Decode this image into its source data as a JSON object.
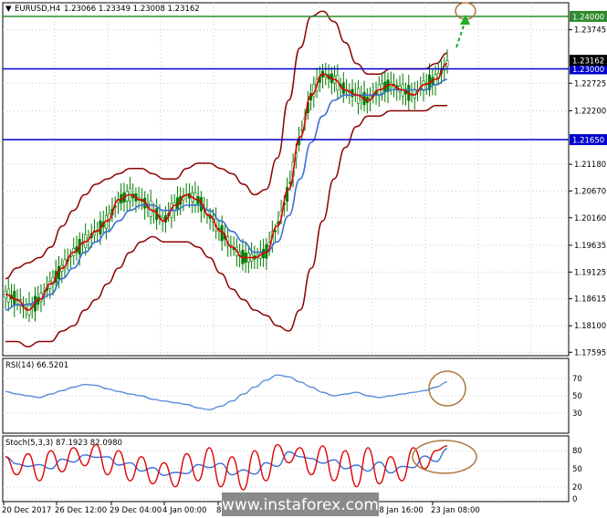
{
  "header": {
    "symbol": "EURUSD,H4",
    "ohlc": "1.23066 1.23349 1.23008 1.23162"
  },
  "price_axis": {
    "ticks": [
      "1.23745",
      "1.22725",
      "1.22200",
      "1.21180",
      "1.20670",
      "1.20160",
      "1.19635",
      "1.19125",
      "1.18615",
      "1.18100",
      "1.17595"
    ],
    "current_price": "1.23162",
    "levels": [
      {
        "label": "1.24000",
        "value": 1.24,
        "color": "#2e8b2e"
      },
      {
        "label": "1.23000",
        "value": 1.23,
        "color": "#0000cc"
      },
      {
        "label": "1.21650",
        "value": 1.2165,
        "color": "#0000cc"
      }
    ]
  },
  "time_axis": {
    "labels": [
      "20 Dec 2017",
      "26 Dec 12:00",
      "29 Dec 04:00",
      "4 Jan 00:00",
      "8",
      "18 Jan 16:00",
      "23 Jan 08:00"
    ]
  },
  "rsi": {
    "title": "RSI(14) 66.5201",
    "ticks": [
      "70",
      "50",
      "30"
    ]
  },
  "stoch": {
    "title": "Stoch(5,3,3) 87.1923 82.0980",
    "ticks": [
      "80",
      "50",
      "20",
      "0"
    ]
  },
  "watermark": "www.instaforex.com",
  "colors": {
    "upper_level": "#2e8b2e",
    "blue_level": "#0000cc",
    "bollinger": "#8b0000",
    "ma_fast": "#e00000",
    "ma_slow": "#3a6fd8",
    "candles": "#007a00",
    "rsi_line": "#5b8fd9",
    "stoch_main": "#e00000",
    "stoch_signal": "#3a6fd8",
    "annotation": "#b07840",
    "arrow": "#22aa22"
  },
  "chart_data": {
    "type": "line",
    "title": "EURUSD,H4",
    "ylim": [
      1.1753,
      1.2426
    ],
    "levels": [
      1.24,
      1.23,
      1.2165
    ],
    "series": [
      {
        "values": [
          1.187,
          1.186,
          1.184,
          1.186,
          1.189,
          1.192,
          1.195,
          1.197,
          1.199,
          1.201,
          1.205,
          1.206,
          1.205,
          1.203,
          1.201,
          1.204,
          1.206,
          1.205,
          1.202,
          1.199,
          1.196,
          1.194,
          1.194,
          1.195,
          1.2,
          1.207,
          1.217,
          1.225,
          1.229,
          1.228,
          1.226,
          1.225,
          1.224,
          1.226,
          1.227,
          1.226,
          1.225,
          1.227,
          1.228,
          1.231
        ]
      },
      {
        "values": [
          1.184,
          1.185,
          1.185,
          1.186,
          1.187,
          1.19,
          1.192,
          1.195,
          1.197,
          1.199,
          1.201,
          1.203,
          1.204,
          1.204,
          1.203,
          1.203,
          1.204,
          1.204,
          1.203,
          1.201,
          1.199,
          1.197,
          1.195,
          1.195,
          1.197,
          1.202,
          1.209,
          1.216,
          1.221,
          1.224,
          1.225,
          1.225,
          1.225,
          1.225,
          1.226,
          1.226,
          1.226,
          1.226,
          1.227,
          1.228
        ]
      }
    ]
  }
}
